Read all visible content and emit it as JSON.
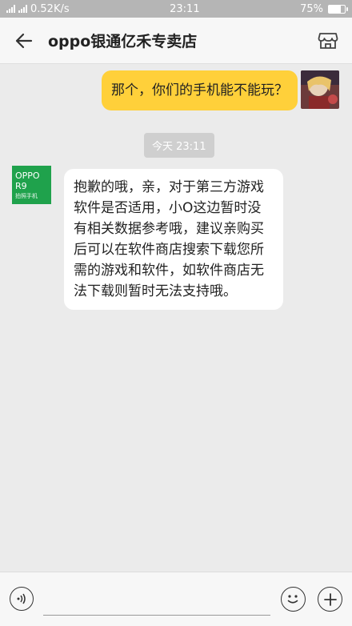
{
  "status_bar": {
    "left_text": "0.52K/s",
    "time": "23:11",
    "battery": "75%",
    "battery_level": 0.75
  },
  "header": {
    "title": "oppo银通亿禾专卖店",
    "back_icon": "arrow-left-icon",
    "store_icon": "store-icon"
  },
  "messages": {
    "outgoing_text": "那个，你们的手机能不能玩？",
    "timestamp": "今天 23:11",
    "shop_avatar_brand": "OPPO R9",
    "shop_avatar_sub": "拍照手机",
    "incoming_text": "抱歉的哦，亲，对于第三方游戏软件是否适用，小O这边暂时没有相关数据参考哦，建议亲购买后可以在软件商店搜索下载您所需的游戏和软件，如软件商店无法下载则暂时无法支持哦。"
  },
  "input_bar": {
    "placeholder": "",
    "voice_icon": "voice-icon",
    "emoji_icon": "emoji-icon",
    "plus_icon": "plus-icon"
  },
  "colors": {
    "outgoing_bubble": "#ffd03a",
    "incoming_bubble": "#ffffff",
    "background": "#ebebeb",
    "shop_brand": "#1fa24c"
  }
}
